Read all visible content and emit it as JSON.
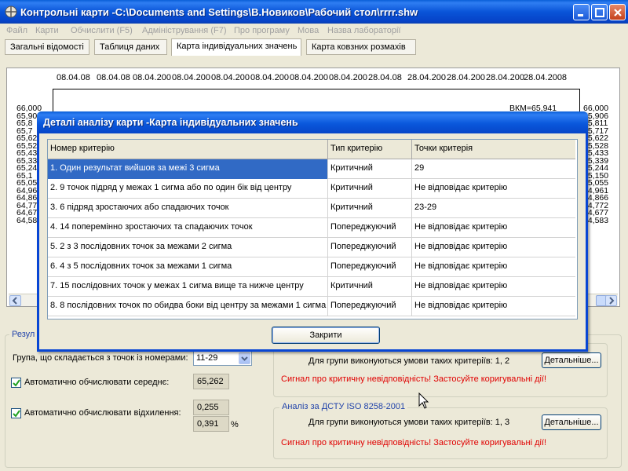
{
  "window": {
    "title": "Контрольні карти -C:\\Documents and Settings\\В.Новиков\\Рабочий стол\\rrrr.shw"
  },
  "menu": [
    "Файл",
    "Карти",
    "Обчислити (F5)",
    "Адміністрування (F7)",
    "Про програму",
    "Мова",
    "Назва лабораторії"
  ],
  "tabs": [
    {
      "label": "Загальні відомості"
    },
    {
      "label": "Таблиця даних"
    },
    {
      "label": "Карта індивідуальних значень"
    },
    {
      "label": "Карта ковзних розмахів"
    }
  ],
  "chart": {
    "dates": [
      "08.04.08",
      "08.04.08",
      "08.04.200",
      "08.04.200",
      "08.04.200",
      "08.04.200",
      "08.04.200",
      "08.04.200",
      "28.04.08",
      "28.04.200",
      "28.04.200",
      "28.04.200",
      "28.04.2008"
    ],
    "y_left": [
      "66,000",
      "65,90",
      "65,8",
      "65,7",
      "65,62",
      "65,52",
      "65,43",
      "65,33",
      "65,24",
      "65,1",
      "65,05",
      "64,96",
      "64,86",
      "64,77",
      "64,67",
      "64,58"
    ],
    "y_right": [
      "66,000",
      "65,906",
      "65,811",
      "65,717",
      "65,622",
      "65,528",
      "65,433",
      "65,339",
      "65,244",
      "65,150",
      "65,055",
      "64,961",
      "64,866",
      "64,772",
      "64,677",
      "64,583"
    ],
    "vkm_label": "ВКМ=65,941"
  },
  "results": {
    "legend": "Резул",
    "group_label": "Група, що складається з точок із номерами:",
    "group_value": "11-29",
    "auto_mean_label": "Автоматично обчислювати середнє:",
    "auto_mean_value": "65,262",
    "auto_dev_label": "Автоматично обчислювати відхилення:",
    "auto_dev_value1": "0,255",
    "auto_dev_value2": "0,391",
    "percent": "%",
    "box1": {
      "criteria_text": "Для групи виконуються умови таких критеріїв: 1, 2",
      "details_button": "Детальніше...",
      "alert": "Сигнал про критичну невідповідність! Застосуйте коригувальні дії!"
    },
    "box2": {
      "legend": "Аналіз за ДСТУ ISO 8258-2001",
      "criteria_text": "Для групи виконуються умови таких критеріїв: 1, 3",
      "details_button": "Детальніше...",
      "alert": "Сигнал про критичну невідповідність! Застосуйте коригувальні дії!"
    }
  },
  "dialog": {
    "title": "Деталі аналізу карти -Карта індивідуальних значень",
    "columns": [
      "Номер критерію",
      "Тип критерію",
      "Точки критерія"
    ],
    "rows": [
      [
        "1. Один результат вийшов за межі 3 сигма",
        "Критичний",
        "29"
      ],
      [
        "2. 9 точок підряд у межах 1 сигма або по один бік від центру",
        "Критичний",
        "Не відповідає критерію"
      ],
      [
        "3. 6 підряд зростаючих або спадаючих точок",
        "Критичний",
        "23-29"
      ],
      [
        "4. 14 поперемінно зростаючих та спадаючих точок",
        "Попереджуючий",
        "Не відповідає критерію"
      ],
      [
        "5. 2 з 3 послідовних точок за межами 2 сигма",
        "Попереджуючий",
        "Не відповідає критерію"
      ],
      [
        "6. 4 з 5 послідовних точок за межами 1 сигма",
        "Попереджуючий",
        "Не відповідає критерію"
      ],
      [
        "7. 15 послідовних точок у межах 1 сигма вище та нижче центру",
        "Критичний",
        "Не відповідає критерію"
      ],
      [
        "8. 8 послідовних точок по обидва боки від центру за межами 1 сигма",
        "Попереджуючий",
        "Не відповідає критерію"
      ]
    ],
    "close_button": "Закрити"
  }
}
